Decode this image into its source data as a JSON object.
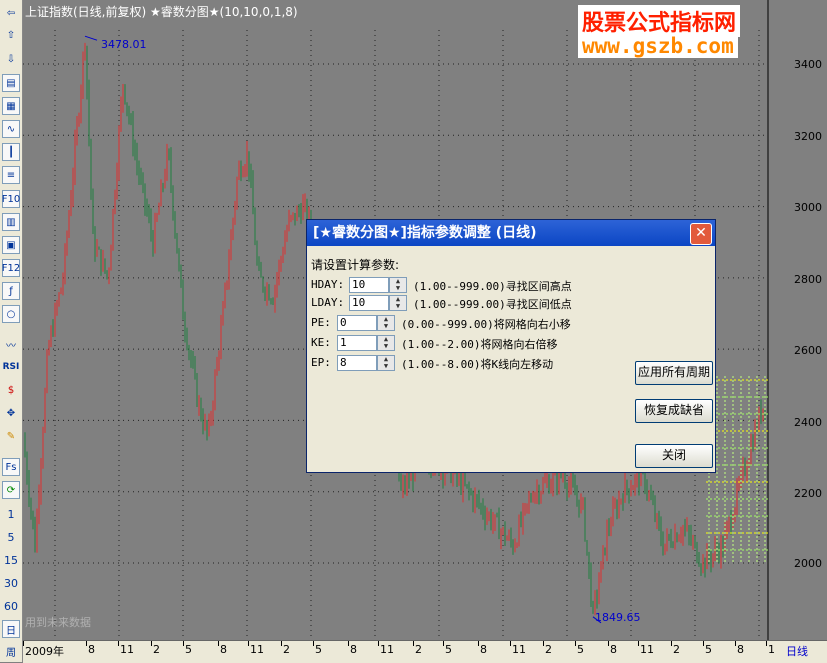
{
  "chart": {
    "title": "上证指数(日线,前复权)",
    "indicator_title": "★睿数分图★(10,10,0,1,8)",
    "peak_label": "3478.01",
    "low_label": "1849.65",
    "future_note": "用到未来数据",
    "y_ticks": [
      "3400",
      "3200",
      "3000",
      "2800",
      "2600",
      "2400",
      "2200",
      "2000"
    ],
    "x_ticks": [
      "2009年",
      "8",
      "11",
      "2",
      "5",
      "8",
      "11",
      "2",
      "5",
      "8",
      "11",
      "2",
      "5",
      "8",
      "11",
      "2",
      "5",
      "8",
      "11",
      "2",
      "5",
      "8",
      "1"
    ],
    "period": "日线"
  },
  "watermark": {
    "line1": "股票公式指标网",
    "line2": "www.gszb.com"
  },
  "toolbar": {
    "numbers": [
      "1",
      "5",
      "15",
      "30",
      "60"
    ],
    "day": "日",
    "week": "周",
    "rsi": "RSI",
    "fs": "Fs",
    "f10": "F10",
    "f12": "F12"
  },
  "dialog": {
    "title": "[★睿数分图★]指标参数调整 (日线)",
    "close": "✕",
    "prompt": "请设置计算参数:",
    "params": [
      {
        "label": "HDAY:",
        "value": "10",
        "desc": "(1.00--999.00)寻找区间高点"
      },
      {
        "label": "LDAY:",
        "value": "10",
        "desc": "(1.00--999.00)寻找区间低点"
      },
      {
        "label": "PE:",
        "value": "0",
        "desc": "(0.00--999.00)将网格向右小移"
      },
      {
        "label": "KE:",
        "value": "1",
        "desc": "(1.00--2.00)将网格向右倍移"
      },
      {
        "label": "EP:",
        "value": "8",
        "desc": "(1.00--8.00)将K线向左移动"
      }
    ],
    "btn_apply_all": "应用所有周期",
    "btn_restore": "恢复成缺省",
    "btn_close": "关闭"
  }
}
